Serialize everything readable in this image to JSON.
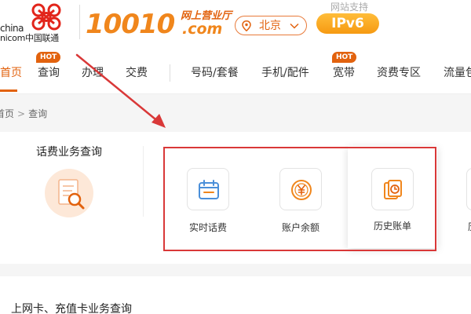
{
  "header": {
    "logo_text_top": "china",
    "logo_text_bottom": "nicom中国联通",
    "brand_number": "10010",
    "brand_cn": "网上营业厅",
    "brand_domain": ".com",
    "city": "北京",
    "support_label": "网站支持",
    "ipv6_label": "IPv6"
  },
  "nav": {
    "items": [
      {
        "label": "首页",
        "active": true
      },
      {
        "label": "查询",
        "hot": true
      },
      {
        "label": "办理"
      },
      {
        "label": "交费"
      },
      {
        "label": "号码/套餐"
      },
      {
        "label": "手机/配件"
      },
      {
        "label": "宽带",
        "hot": true
      },
      {
        "label": "资费专区"
      },
      {
        "label": "流量包"
      }
    ],
    "hot_label": "HOT"
  },
  "breadcrumb": {
    "home": "首页",
    "separator": ">",
    "current": "查询"
  },
  "query": {
    "category_title": "话费业务查询",
    "services": [
      {
        "label": "实时话费",
        "icon": "calendar-icon"
      },
      {
        "label": "账户余额",
        "icon": "yuan-coin-icon"
      },
      {
        "label": "历史账单",
        "icon": "bill-history-icon"
      }
    ],
    "next_service_partial": "历"
  },
  "section2": {
    "title": "上网卡、充值卡业务查询"
  },
  "colors": {
    "brand_orange": "#f0861c",
    "accent": "#e2620e",
    "annotation_red": "#d93838",
    "icon_blue": "#4a8fd9"
  }
}
